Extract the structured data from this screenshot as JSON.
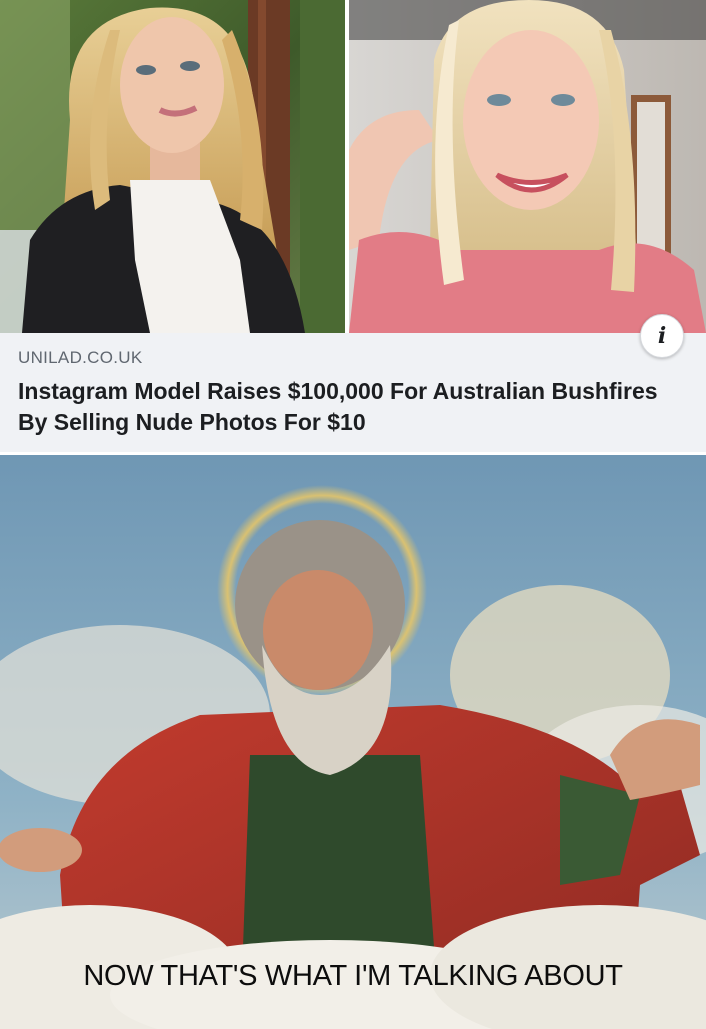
{
  "link_card": {
    "domain": "UNILAD.CO.UK",
    "headline": "Instagram Model Raises $100,000 For Australian Bushfires By Selling Nude Photos For $10",
    "info_icon": "info-icon",
    "info_label": "i"
  },
  "meme": {
    "caption": "NOW THAT'S WHAT I'M TALKING ABOUT"
  },
  "colors": {
    "card_background": "#f0f2f5",
    "headline_text": "#1c1e21",
    "domain_text": "#606770",
    "robe_red": "#b8322a",
    "robe_green": "#2f4a2c",
    "halo_gold": "#e4c56a",
    "sky_blue": "#7fa6bf"
  }
}
